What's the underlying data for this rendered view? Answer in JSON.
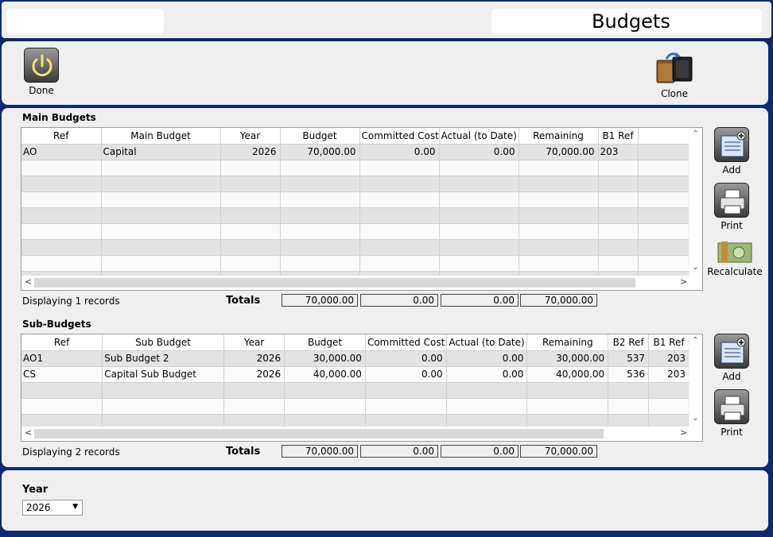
{
  "header": {
    "title": "Budgets",
    "left_title": ""
  },
  "toolbar": {
    "done_label": "Done",
    "clone_label": "Clone"
  },
  "main_budgets": {
    "title": "Main Budgets",
    "columns": [
      "Ref",
      "Main Budget",
      "Year",
      "Budget",
      "Committed Cost",
      "Actual (to Date)",
      "Remaining",
      "B1 Ref",
      ""
    ],
    "rows": [
      [
        "AO",
        "Capital",
        "2026",
        "70,000.00",
        "0.00",
        "0.00",
        "70,000.00",
        "203",
        ""
      ]
    ],
    "empty_rows": 8,
    "records_text": "Displaying 1 records",
    "totals_label": "Totals",
    "totals": [
      "70,000.00",
      "0.00",
      "0.00",
      "70,000.00"
    ],
    "add_label": "Add",
    "print_label": "Print",
    "recalculate_label": "Recalculate"
  },
  "sub_budgets": {
    "title": "Sub-Budgets",
    "columns": [
      "Ref",
      "Sub Budget",
      "Year",
      "Budget",
      "Committed Cost",
      "Actual (to Date)",
      "Remaining",
      "B2 Ref",
      "B1 Ref"
    ],
    "rows": [
      [
        "AO1",
        "Sub Budget 2",
        "2026",
        "30,000.00",
        "0.00",
        "0.00",
        "30,000.00",
        "537",
        "203"
      ],
      [
        "CS",
        "Capital Sub Budget",
        "2026",
        "40,000.00",
        "0.00",
        "0.00",
        "40,000.00",
        "536",
        "203"
      ]
    ],
    "empty_rows": 3,
    "records_text": "Displaying 2 records",
    "totals_label": "Totals",
    "totals": [
      "70,000.00",
      "0.00",
      "0.00",
      "70,000.00"
    ],
    "add_label": "Add",
    "print_label": "Print"
  },
  "year_filter": {
    "label": "Year",
    "value": "2026"
  },
  "icons": {
    "done": "power-icon",
    "clone": "wallet-clone-icon",
    "add": "add-record-icon",
    "print": "printer-icon",
    "recalculate": "money-icon"
  }
}
